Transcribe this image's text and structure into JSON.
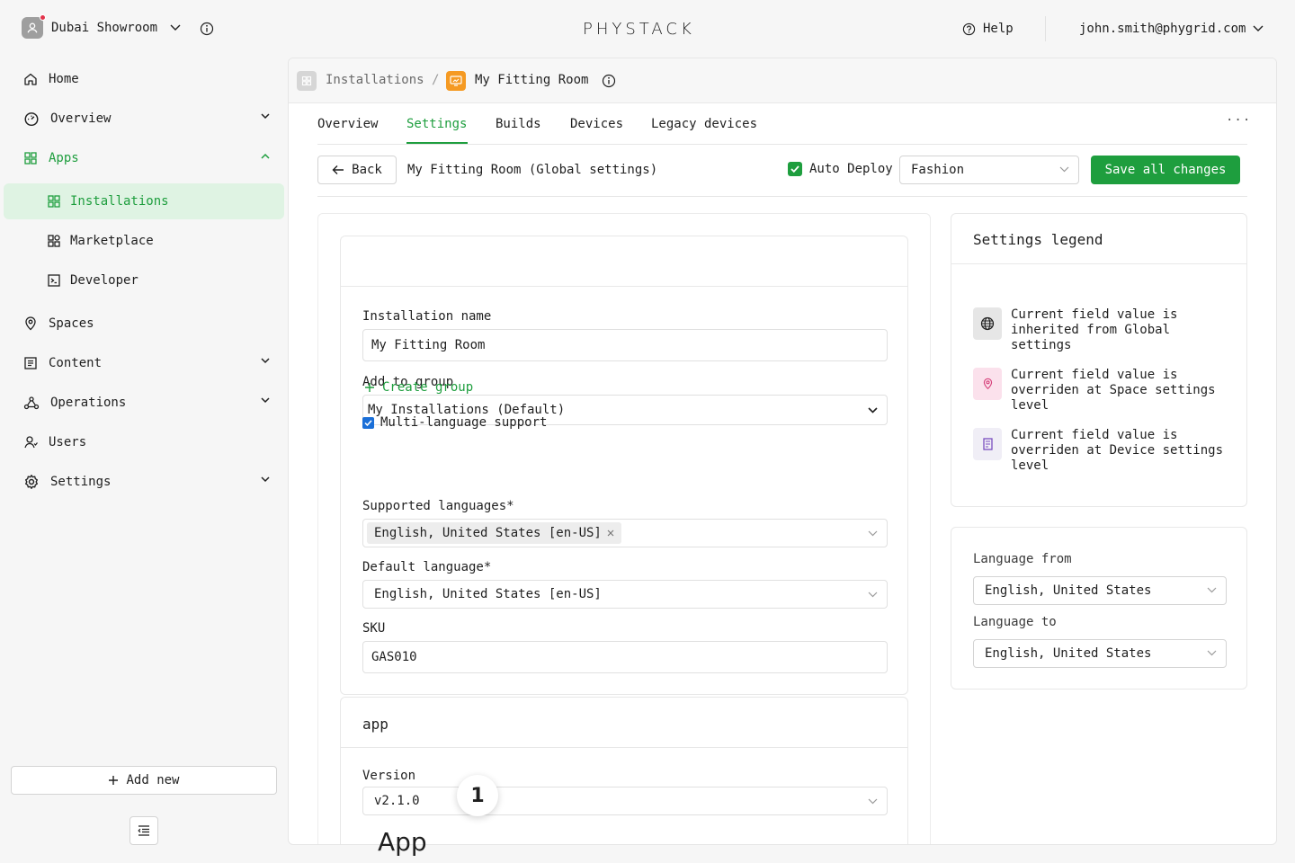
{
  "topbar": {
    "org_name": "Dubai Showroom",
    "logo": "PHYSTACK",
    "help": "Help",
    "user_email": "john.smith@phygrid.com"
  },
  "sidebar": {
    "items": [
      {
        "label": "Home",
        "icon": "home-icon"
      },
      {
        "label": "Overview",
        "icon": "dashboard-icon"
      },
      {
        "label": "Apps",
        "icon": "apps-icon"
      },
      {
        "label": "Spaces",
        "icon": "location-icon"
      },
      {
        "label": "Content",
        "icon": "content-icon"
      },
      {
        "label": "Operations",
        "icon": "operations-icon"
      },
      {
        "label": "Users",
        "icon": "users-icon"
      },
      {
        "label": "Settings",
        "icon": "gear-icon"
      }
    ],
    "apps_sub": [
      {
        "label": "Installations",
        "icon": "grid-icon"
      },
      {
        "label": "Marketplace",
        "icon": "marketplace-icon"
      },
      {
        "label": "Developer",
        "icon": "terminal-icon"
      }
    ],
    "add_new": "Add new"
  },
  "breadcrumb": {
    "root": "Installations",
    "separator": "/",
    "current": "My Fitting Room"
  },
  "tabs": [
    "Overview",
    "Settings",
    "Builds",
    "Devices",
    "Legacy devices"
  ],
  "active_tab": "Settings",
  "more": "···",
  "actionbar": {
    "back": "Back",
    "subtitle": "My Fitting Room (Global settings)",
    "auto_deploy": "Auto Deploy",
    "auto_deploy_checked": true,
    "environment": "Fashion",
    "save": "Save all changes"
  },
  "form": {
    "installation_name_label": "Installation name",
    "installation_name_value": "My Fitting Room",
    "group_label": "Add to group",
    "group_value": "My Installations (Default)",
    "create_group": "Create group",
    "multilang_label": "Multi-language support",
    "multilang_checked": true,
    "supported_languages_label": "Supported languages*",
    "supported_languages_tag": "English, United States [en-US]",
    "default_language_label": "Default language*",
    "default_language_value": "English, United States [en-US]",
    "sku_label": "SKU",
    "sku_value": "GAS010",
    "app_section_title": "app",
    "version_label": "Version",
    "version_value": "v2.1.0",
    "badge": "1",
    "app_heading_cut": "App"
  },
  "legend": {
    "title": "Settings legend",
    "rows": [
      {
        "icon": "globe-icon",
        "text": "Current field value is inherited from Global settings",
        "bg": "#e6e6e6"
      },
      {
        "icon": "location-pin-icon",
        "text": "Current field value is overriden at Space settings level",
        "bg": "#fbe1ec"
      },
      {
        "icon": "device-icon",
        "text": "Current field value is overriden at Device settings level",
        "bg": "#f0eef6"
      }
    ]
  },
  "language": {
    "from_label": "Language from",
    "from_value": "English, United States",
    "to_label": "Language to",
    "to_value": "English, United States"
  },
  "colors": {
    "accent": "#1e9e3e",
    "active_bg": "#dff3e3",
    "app_icon": "#f59a23"
  }
}
